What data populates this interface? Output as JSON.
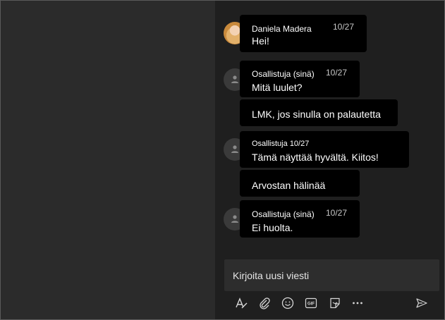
{
  "messages": [
    {
      "sender": "Daniela Madera",
      "time": "10/27",
      "text": "Hei!"
    },
    {
      "sender": "Osallistuja (sinä)",
      "time": "10/27",
      "text": "Mitä luulet?"
    },
    {
      "text": "LMK, jos sinulla on palautetta"
    },
    {
      "sender": "Osallistuja",
      "time": "10/27",
      "text": "Tämä näyttää hyvältä. Kiitos!"
    },
    {
      "text": "Arvostan hälinää"
    },
    {
      "sender": "Osallistuja (sinä)",
      "time": "10/27",
      "text": "Ei huolta."
    }
  ],
  "compose": {
    "placeholder": "Kirjoita uusi viesti"
  },
  "toolbar": {
    "icons": [
      "format-icon",
      "attach-icon",
      "emoji-icon",
      "gif-icon",
      "sticker-icon",
      "more-icon",
      "send-icon"
    ],
    "gif_label": "GIF"
  }
}
